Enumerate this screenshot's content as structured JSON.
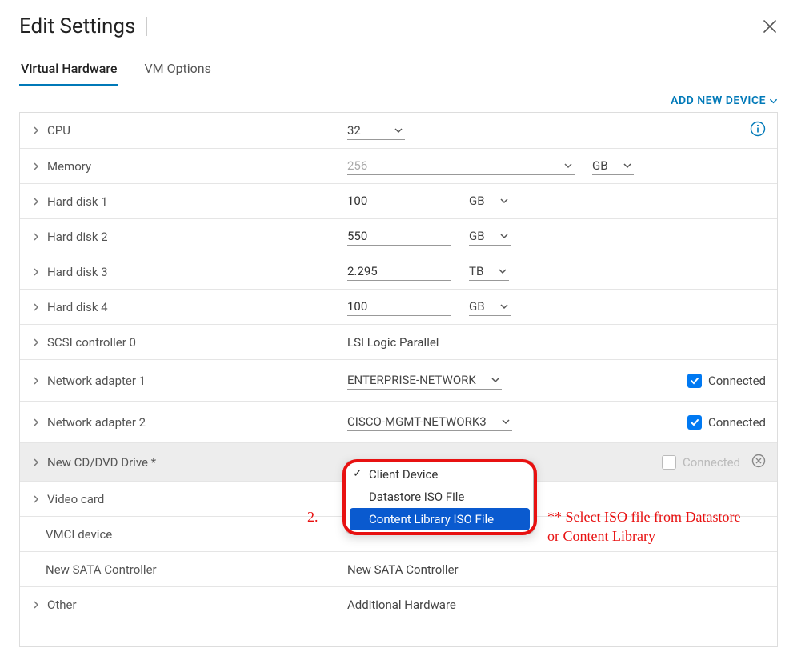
{
  "header": {
    "title": "Edit Settings"
  },
  "tabs": {
    "virtual_hardware": "Virtual Hardware",
    "vm_options": "VM Options"
  },
  "toolbar": {
    "add_new_device": "ADD NEW DEVICE"
  },
  "rows": {
    "cpu": {
      "label": "CPU",
      "value": "32"
    },
    "memory": {
      "label": "Memory",
      "value": "256",
      "unit": "GB"
    },
    "hd1": {
      "label": "Hard disk 1",
      "value": "100",
      "unit": "GB"
    },
    "hd2": {
      "label": "Hard disk 2",
      "value": "550",
      "unit": "GB"
    },
    "hd3": {
      "label": "Hard disk 3",
      "value": "2.295",
      "unit": "TB"
    },
    "hd4": {
      "label": "Hard disk 4",
      "value": "100",
      "unit": "GB"
    },
    "scsi": {
      "label": "SCSI controller 0",
      "value": "LSI Logic Parallel"
    },
    "net1": {
      "label": "Network adapter 1",
      "value": "ENTERPRISE-NETWORK",
      "connected": "Connected"
    },
    "net2": {
      "label": "Network adapter 2",
      "value": "CISCO-MGMT-NETWORK3",
      "connected": "Connected"
    },
    "dvd": {
      "label": "New CD/DVD Drive *",
      "connected": "Connected"
    },
    "video": {
      "label": "Video card"
    },
    "vmci": {
      "label": "VMCI device"
    },
    "sata": {
      "label": "New SATA Controller",
      "value": "New SATA Controller"
    },
    "other": {
      "label": "Other",
      "value": "Additional Hardware"
    }
  },
  "dropdown": {
    "item1": "Client Device",
    "item2": "Datastore ISO File",
    "item3": "Content Library ISO File"
  },
  "annotations": {
    "num": "2.",
    "text": "** Select ISO file from Datastore or Content Library"
  }
}
